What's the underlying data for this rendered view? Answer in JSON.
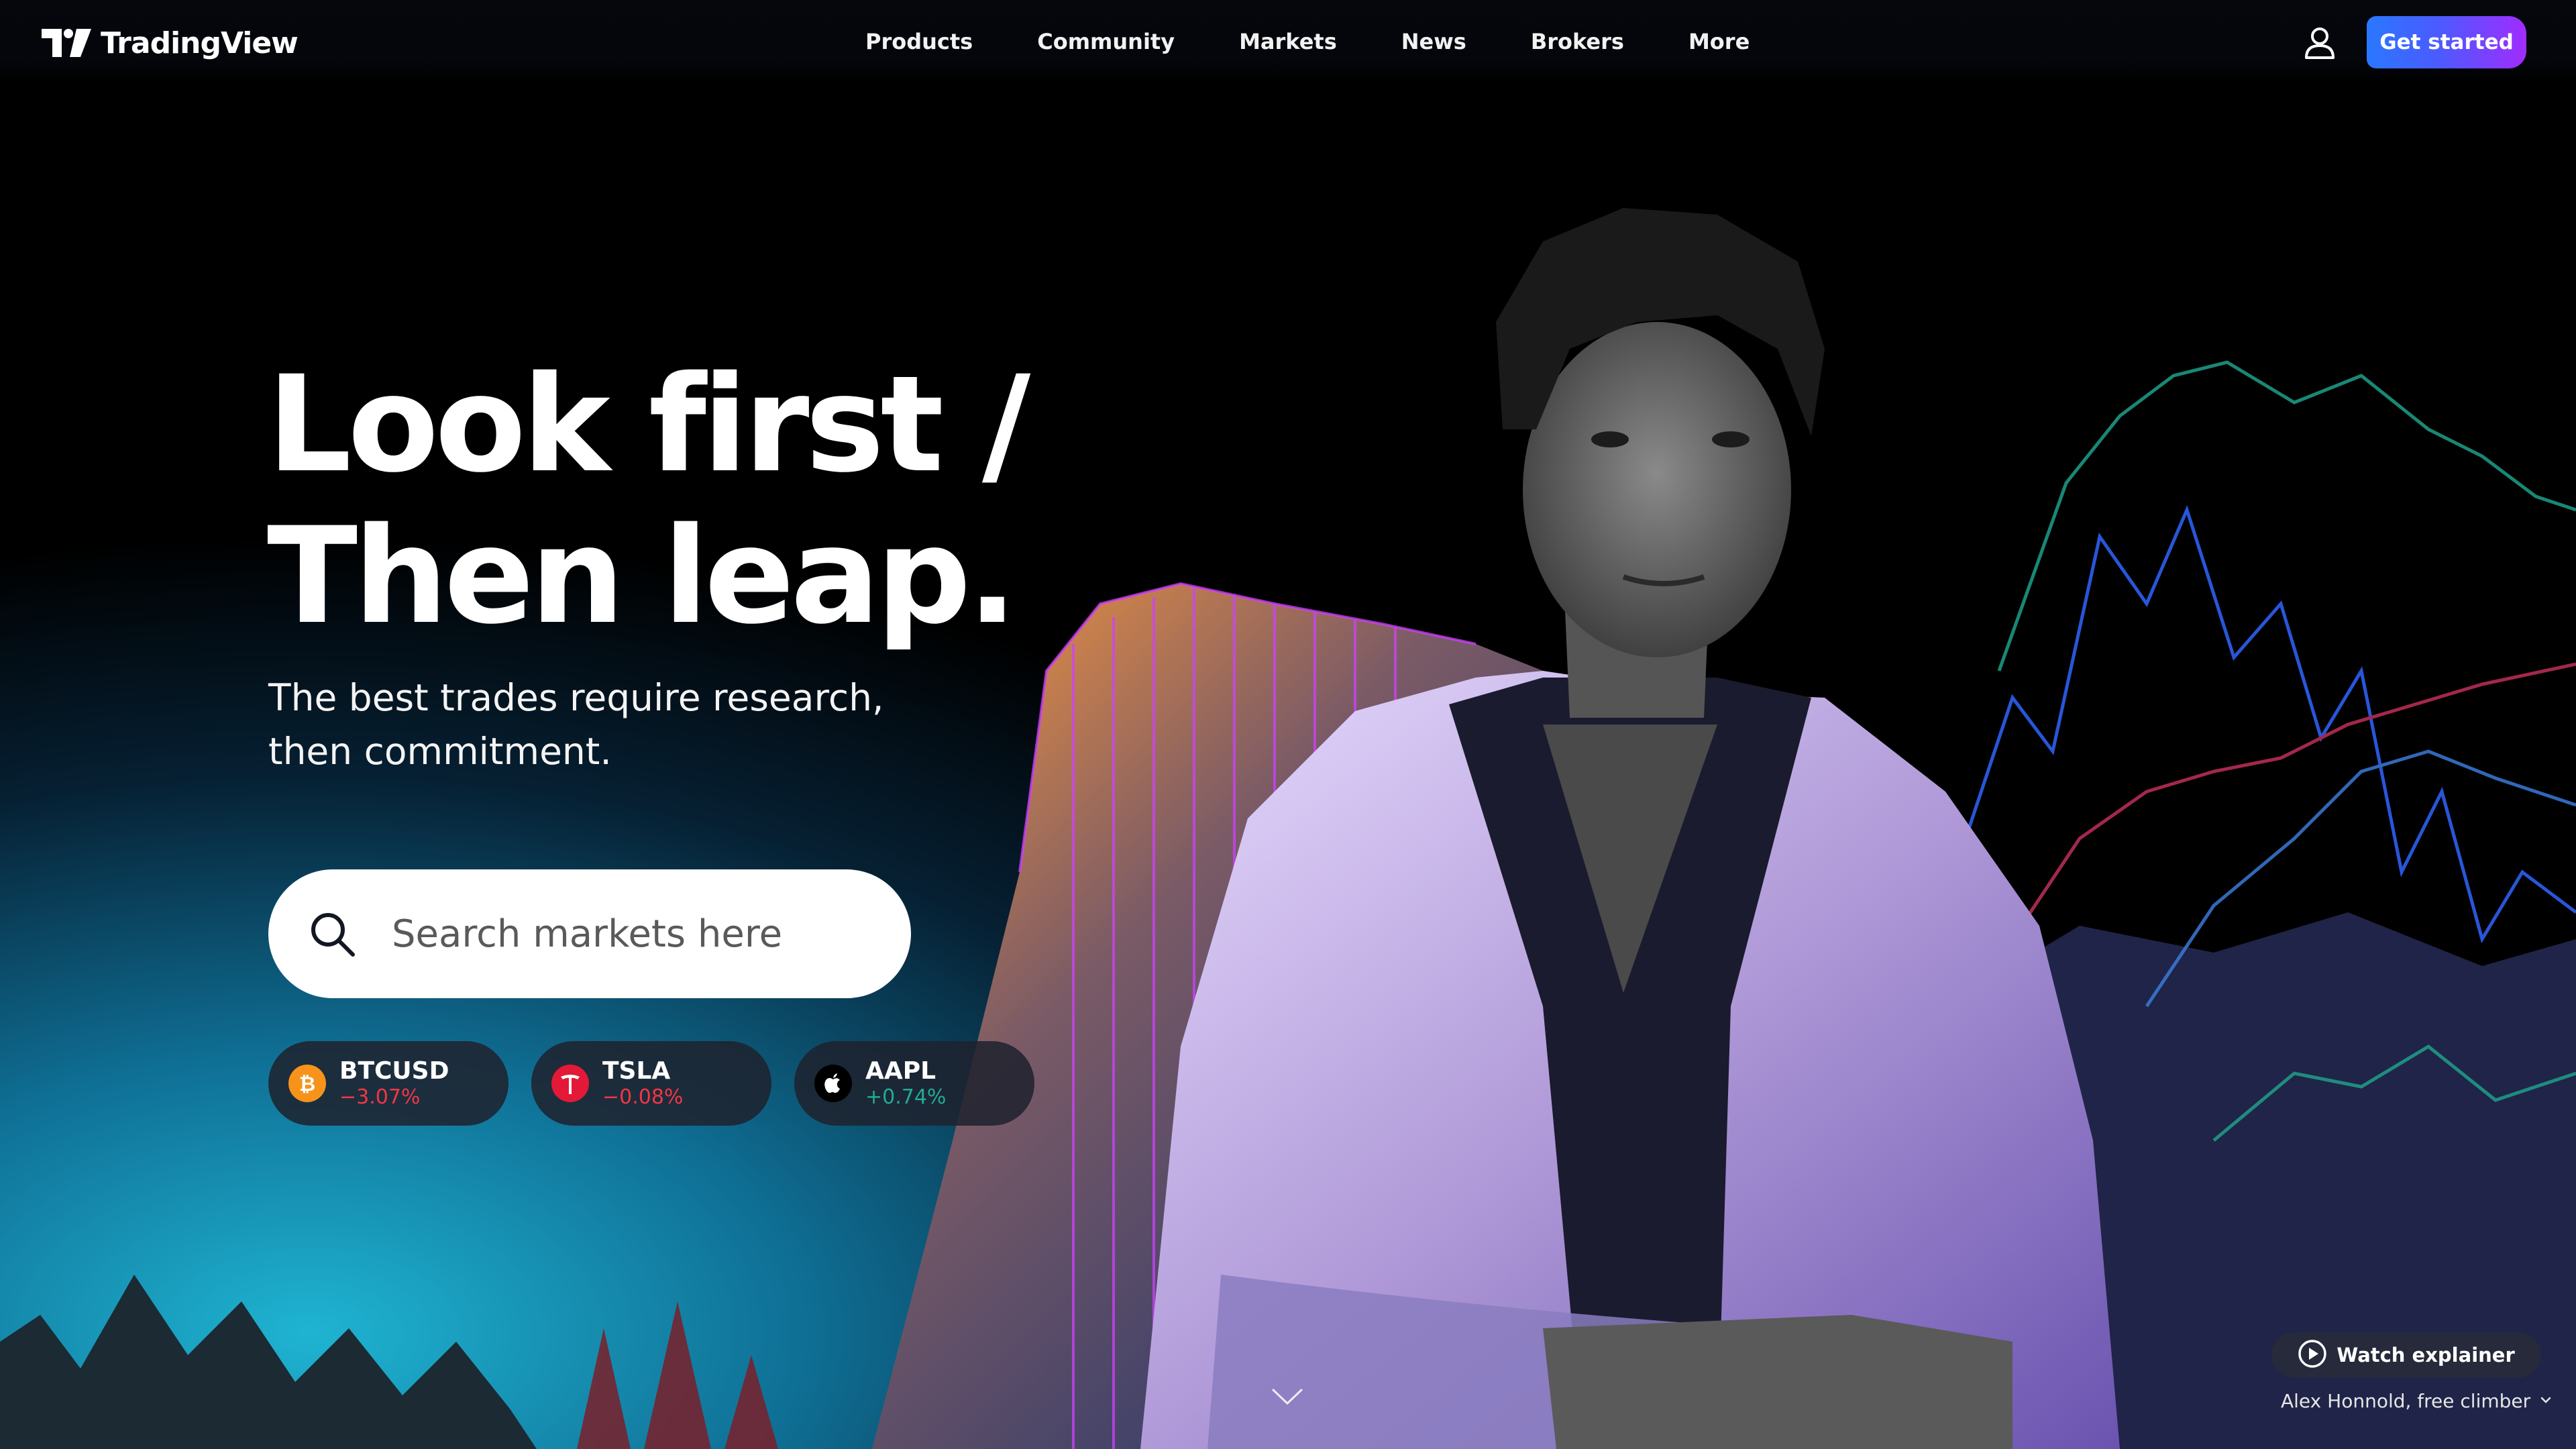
{
  "header": {
    "brand": "TradingView",
    "nav": [
      "Products",
      "Community",
      "Markets",
      "News",
      "Brokers",
      "More"
    ],
    "cta_label": "Get started",
    "user_icon": "user-icon"
  },
  "hero": {
    "headline_line1": "Look first /",
    "headline_line2": "Then leap.",
    "subhead": "The best trades require research, then commitment."
  },
  "search": {
    "placeholder": "Search markets here",
    "value": "",
    "icon": "search-icon"
  },
  "tickers": [
    {
      "symbol": "BTCUSD",
      "change": "−3.07%",
      "direction": "down",
      "icon": "bitcoin-icon",
      "icon_color": "#f7931a"
    },
    {
      "symbol": "TSLA",
      "change": "−0.08%",
      "direction": "down",
      "icon": "tesla-icon",
      "icon_color": "#e31937"
    },
    {
      "symbol": "AAPL",
      "change": "+0.74%",
      "direction": "up",
      "icon": "apple-icon",
      "icon_color": "#000000"
    }
  ],
  "footer": {
    "watch_label": "Watch explainer",
    "credit": "Alex Honnold, free climber"
  },
  "colors": {
    "down": "#f23645",
    "up": "#22ab94",
    "cta_start": "#2a78ff",
    "cta_end": "#a12cff",
    "chip_bg": "#1e222d"
  }
}
